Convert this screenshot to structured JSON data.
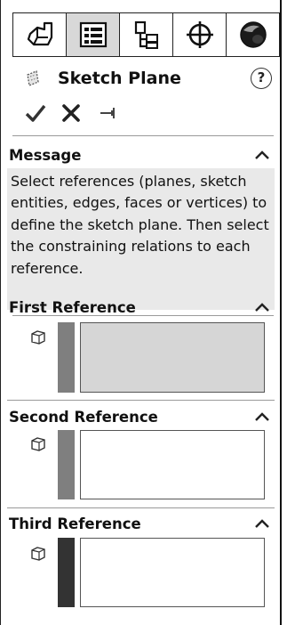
{
  "tabs": [
    {
      "icon": "feature-manager-icon",
      "active": false
    },
    {
      "icon": "property-manager-icon",
      "active": true
    },
    {
      "icon": "configuration-manager-icon",
      "active": false
    },
    {
      "icon": "dimxpert-manager-icon",
      "active": false
    },
    {
      "icon": "display-manager-icon",
      "active": false
    }
  ],
  "header": {
    "title": "Sketch Plane",
    "title_icon": "sketch-plane-icon",
    "help_label": "?"
  },
  "actions": {
    "ok_icon": "checkmark-icon",
    "cancel_icon": "close-icon",
    "pin_icon": "pushpin-icon"
  },
  "message": {
    "title": "Message",
    "text": "Select references (planes, sketch entities, edges, faces or vertices) to define the sketch plane. Then select the constraining relations to each reference."
  },
  "references": [
    {
      "title": "First Reference",
      "selection_state": "active",
      "bar_color": "#7f7f7f",
      "box_fill": "#d6d6d6"
    },
    {
      "title": "Second Reference",
      "selection_state": "inactive",
      "bar_color": "#7f7f7f",
      "box_fill": "#ffffff"
    },
    {
      "title": "Third Reference",
      "selection_state": "inactive",
      "bar_color": "#333333",
      "box_fill": "#ffffff"
    }
  ],
  "colors": {
    "message_background": "#e9e9e9",
    "active_tab": "#d8d8d8",
    "border": "#222222"
  }
}
